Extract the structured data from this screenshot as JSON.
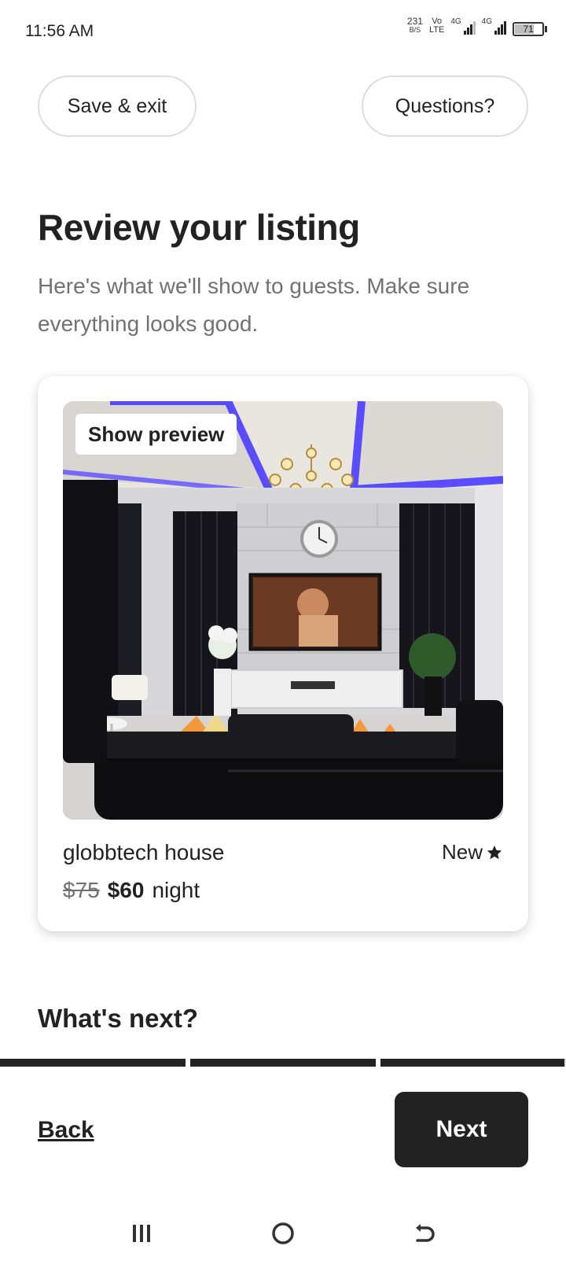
{
  "status_bar": {
    "time": "11:56 AM",
    "net_speed_value": "231",
    "net_speed_unit": "B/S",
    "volte_top": "Vo",
    "volte_bottom": "LTE",
    "sim1_label": "4G",
    "sim2_label": "4G",
    "battery_level": "71"
  },
  "header": {
    "save_exit_label": "Save & exit",
    "questions_label": "Questions?"
  },
  "main": {
    "title": "Review your listing",
    "subtitle": "Here's what we'll show to guests. Make sure everything looks good."
  },
  "listing": {
    "preview_label": "Show preview",
    "name": "globbtech house",
    "rating_label": "New",
    "original_price": "$75",
    "price": "$60",
    "price_unit": "night",
    "photo_icon": "living-room-photo"
  },
  "whats_next": {
    "title": "What's next?"
  },
  "progress": {
    "steps": [
      1.0,
      1.0,
      0.99
    ]
  },
  "footer": {
    "back_label": "Back",
    "next_label": "Next"
  },
  "system_nav": {
    "recents_icon": "recents-icon",
    "home_icon": "home-icon",
    "back_icon": "back-arrow-icon"
  },
  "colors": {
    "text_primary": "#222222",
    "text_secondary": "#717171",
    "button_dark": "#222222",
    "accent_led": "#4a3cff"
  }
}
